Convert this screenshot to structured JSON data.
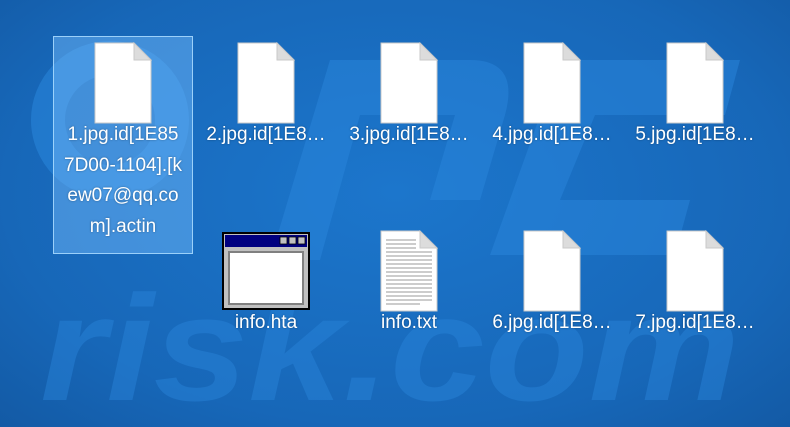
{
  "desktop": {
    "background_color": "#1a6fc2",
    "watermark_text": "risk.com",
    "items": [
      {
        "name": "1.jpg.id[1E857D00-1104].[kew07@qq.com].actin",
        "label": "1.jpg.id[1E857D00-1104].[kew07@qq.com].actin",
        "icon": "blank-file-icon",
        "selected": true
      },
      {
        "name": "2.jpg.id[1E8",
        "label": "2.jpg.id[1E8…",
        "icon": "blank-file-icon",
        "selected": false
      },
      {
        "name": "3.jpg.id[1E8",
        "label": "3.jpg.id[1E8…",
        "icon": "blank-file-icon",
        "selected": false
      },
      {
        "name": "4.jpg.id[1E8",
        "label": "4.jpg.id[1E8…",
        "icon": "blank-file-icon",
        "selected": false
      },
      {
        "name": "5.jpg.id[1E8",
        "label": "5.jpg.id[1E8…",
        "icon": "blank-file-icon",
        "selected": false
      },
      {
        "name": "info.hta",
        "label": "info.hta",
        "icon": "hta-window-icon",
        "selected": false
      },
      {
        "name": "info.txt",
        "label": "info.txt",
        "icon": "text-file-icon",
        "selected": false
      },
      {
        "name": "6.jpg.id[1E8",
        "label": "6.jpg.id[1E8…",
        "icon": "blank-file-icon",
        "selected": false
      },
      {
        "name": "7.jpg.id[1E8",
        "label": "7.jpg.id[1E8…",
        "icon": "blank-file-icon",
        "selected": false
      }
    ]
  }
}
